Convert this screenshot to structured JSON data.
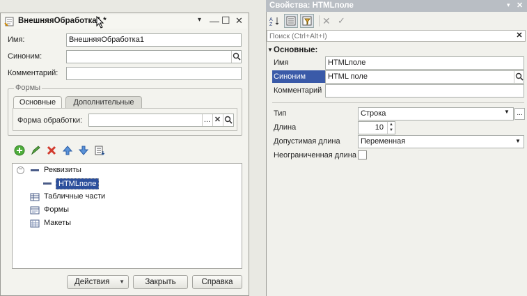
{
  "left_window": {
    "title": "ВнешняяОбработка1 *",
    "controls": {
      "pin": "▾",
      "minimize": "—",
      "maximize": "☐",
      "close": "✕"
    },
    "fields": {
      "name_label": "Имя:",
      "name_value": "ВнешняяОбработка1",
      "synonym_label": "Синоним:",
      "synonym_value": "",
      "comment_label": "Комментарий:",
      "comment_value": ""
    },
    "forms_group": {
      "title": "Формы",
      "tabs": [
        {
          "label": "Основные"
        },
        {
          "label": "Дополнительные"
        }
      ],
      "processing_form_label": "Форма обработки:",
      "processing_form_value": "",
      "select_button": "...",
      "clear_button": "✕",
      "search_button": "🔍"
    },
    "tree": {
      "items": [
        {
          "label": "Реквизиты"
        },
        {
          "label": "HTMLполе"
        },
        {
          "label": "Табличные части"
        },
        {
          "label": "Формы"
        },
        {
          "label": "Макеты"
        }
      ]
    },
    "buttons": {
      "actions": "Действия",
      "close": "Закрыть",
      "help": "Справка"
    }
  },
  "right_panel": {
    "title": "Свойства: HTMLполе",
    "controls": {
      "pin": "▾",
      "close": "✕"
    },
    "search_placeholder": "Поиск (Ctrl+Alt+I)",
    "section_title": "Основные:",
    "props": {
      "name_label": "Имя",
      "name_value": "HTMLполе",
      "synonym_label": "Синоним",
      "synonym_value": "HTML поле",
      "comment_label": "Комментарий",
      "comment_value": "",
      "type_label": "Тип",
      "type_value": "Строка",
      "length_label": "Длина",
      "length_value": "10",
      "allowed_length_label": "Допустимая длина",
      "allowed_length_value": "Переменная",
      "unlimited_length_label": "Неограниченная длина"
    }
  },
  "colors": {
    "panel_title_bg": "#b9bec4",
    "selected_label_bg": "#3a5aa8",
    "tree_selection": "#2c4f9c"
  }
}
